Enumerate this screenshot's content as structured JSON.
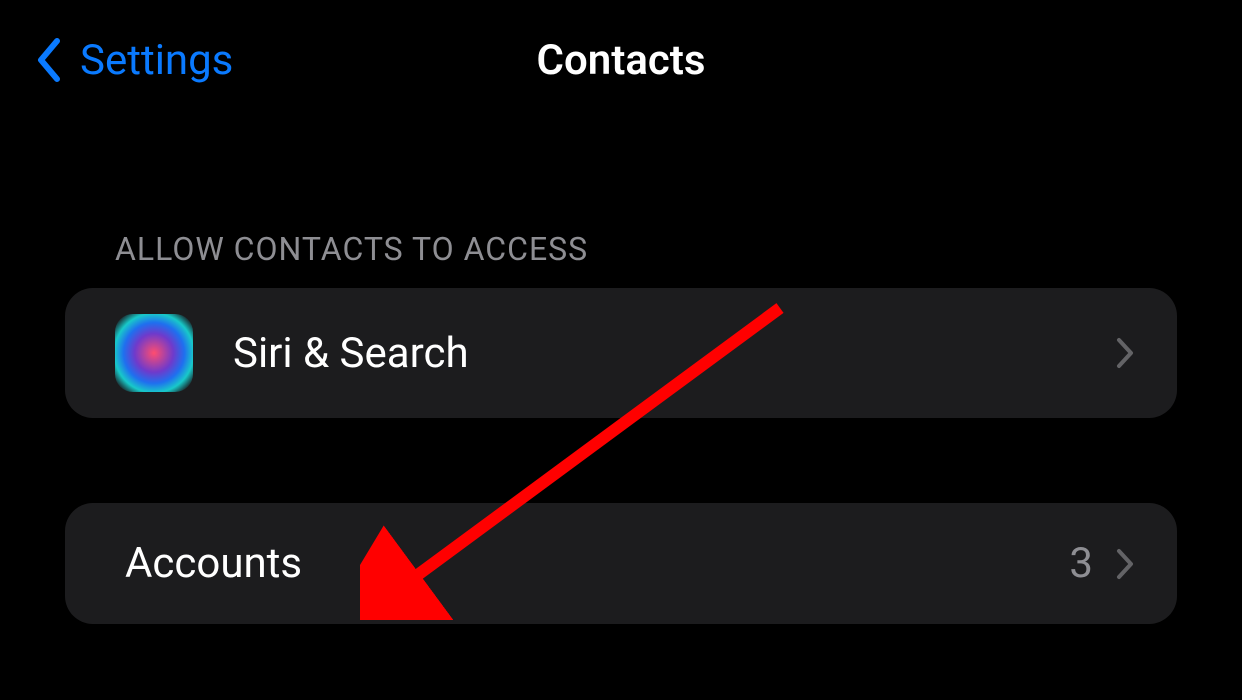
{
  "header": {
    "back_label": "Settings",
    "title": "Contacts"
  },
  "sections": {
    "access": {
      "header": "ALLOW CONTACTS TO ACCESS",
      "rows": {
        "siri": {
          "label": "Siri & Search"
        }
      }
    },
    "accounts": {
      "rows": {
        "accounts": {
          "label": "Accounts",
          "value": "3"
        }
      }
    }
  },
  "colors": {
    "accent": "#0a7aff",
    "background": "#000000",
    "row_bg": "#1c1c1e",
    "secondary_text": "#8e8e93",
    "annotation": "#ff0000"
  }
}
